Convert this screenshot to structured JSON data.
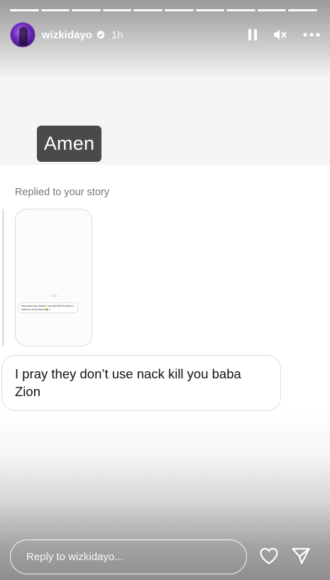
{
  "header": {
    "username": "wizkidayo",
    "time_ago": "1h",
    "progress_segments": 10
  },
  "sticker": {
    "text": "Amen"
  },
  "reply": {
    "label": "Replied to your story",
    "story_preview": {
      "time": "12:08",
      "text": "Hey baba any chance I can get that bio back it was one of my faves 😭 x"
    },
    "message": "I pray they don’t use nack kill you baba Zion"
  },
  "footer": {
    "input_placeholder": "Reply to wizkidayo..."
  },
  "colors": {
    "overlay_text": "#ffffff",
    "sticker_bg": "#4a4a4a",
    "verified_badge": "#ffffff"
  }
}
